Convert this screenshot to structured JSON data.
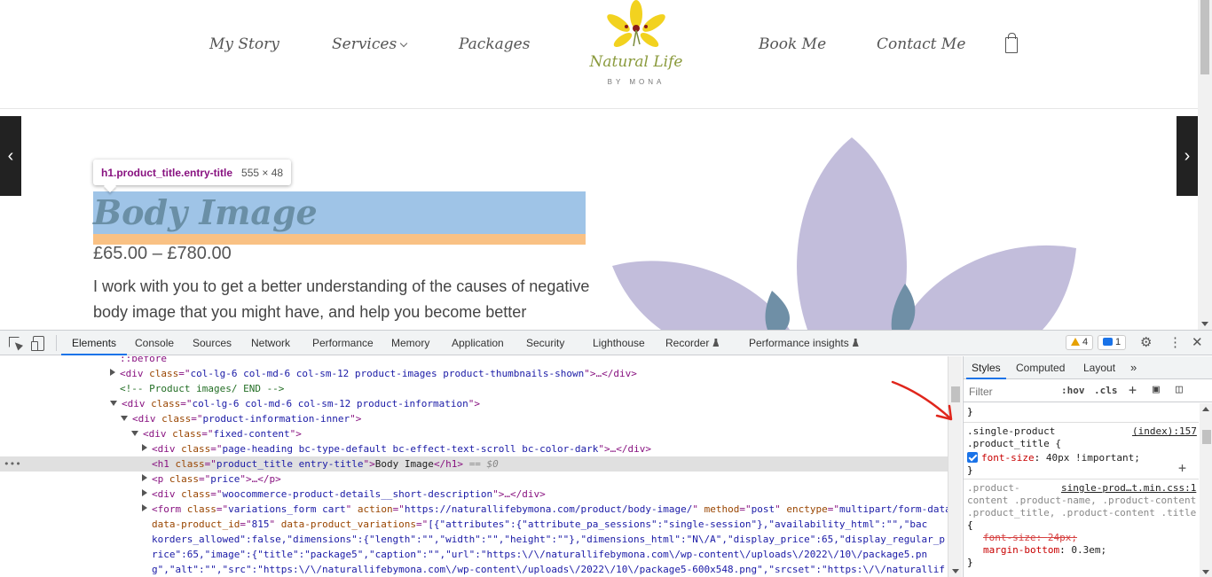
{
  "site": {
    "nav": {
      "my_story": "My Story",
      "services": "Services",
      "packages": "Packages",
      "book_me": "Book Me",
      "contact_me": "Contact Me"
    },
    "logo": {
      "name": "Natural Life",
      "sub": "BY MONA"
    },
    "tooltip": {
      "selector": "h1.product_title.entry-title",
      "dims": "555 × 48"
    },
    "product": {
      "title": "Body Image",
      "price": "£65.00 – £780.00",
      "description": "I work with you to get a better understanding of the causes of negative body image that you might have, and help you become better equipped"
    },
    "colors": {
      "highlight_content": "#9fc4e7",
      "highlight_margin": "#f9c184",
      "logo_petal": "#f2d21f",
      "leaf": "#c2bddb"
    }
  },
  "devtools": {
    "tabs": [
      "Elements",
      "Console",
      "Sources",
      "Network",
      "Performance",
      "Memory",
      "Application",
      "Security",
      "Lighthouse",
      "Recorder",
      "Performance insights"
    ],
    "warnings": "4",
    "messages": "1",
    "elements": {
      "before": "::before",
      "row1": {
        "class": "col-lg-6 col-md-6 col-sm-12 product-images  product-thumbnails-shown",
        "tail": ">…</div>"
      },
      "comment": "<!-- Product images/ END -->",
      "row3": {
        "class": "col-lg-6 col-md-6 col-sm-12 product-information"
      },
      "row4": {
        "class": "product-information-inner"
      },
      "row5": {
        "class": "fixed-content"
      },
      "row6": {
        "class": "page-heading bc-type-default bc-effect-text-scroll bc-color-dark",
        "tail": ">…</div>"
      },
      "row7": {
        "class": "product_title entry-title",
        "text": "Body Image",
        "eq": "== $0"
      },
      "row8": {
        "class": "price",
        "tail": ">…</p>"
      },
      "row9": {
        "class": "woocommerce-product-details__short-description",
        "tail": ">…</div>"
      },
      "row10": {
        "class": "variations_form cart",
        "action": "https://naturallifebymona.com/product/body-image/",
        "method": "post",
        "enctype": "multipart/form-data",
        "pid": "815",
        "vars_start": "[{\"attributes\":{\"attribute_pa_sessions\":\"single-session\"},\"availability_html\":\"\",\"bac"
      },
      "wrap1": "korders_allowed\":false,\"dimensions\":{\"length\":\"\",\"width\":\"\",\"height\":\"\"},\"dimensions_html\":\"N\\/A\",\"display_price\":65,\"display_regular_p",
      "wrap2": "rice\":65,\"image\":{\"title\":\"package5\",\"caption\":\"\",\"url\":\"https:\\/\\/naturallifebymona.com\\/wp-content\\/uploads\\/2022\\/10\\/package5.pn",
      "wrap3": "g\",\"alt\":\"\",\"src\":\"https:\\/\\/naturallifebymona.com\\/wp-content\\/uploads\\/2022\\/10\\/package5-600x548.png\",\"srcset\":\"https:\\/\\/naturallif"
    },
    "styles": {
      "tabs": [
        "Styles",
        "Computed",
        "Layout"
      ],
      "filter_placeholder": "Filter",
      "hov": ":hov",
      "cls": ".cls",
      "rule1": {
        "sel1": ".single-product",
        "sel2": ".product_title {",
        "source": "(index):157",
        "prop": "font-size",
        "value": "40px !important;"
      },
      "rule2": {
        "sel1": ".product-",
        "source": "single-prod…t.min.css:1",
        "sel2": "content .product-name, .product-content",
        "sel3": ".product_title, .product-content .title",
        "brace": "{",
        "prop1": "font-size",
        "val1": "24px;",
        "prop2": "margin-bottom",
        "val2": "0.3em;"
      }
    }
  }
}
